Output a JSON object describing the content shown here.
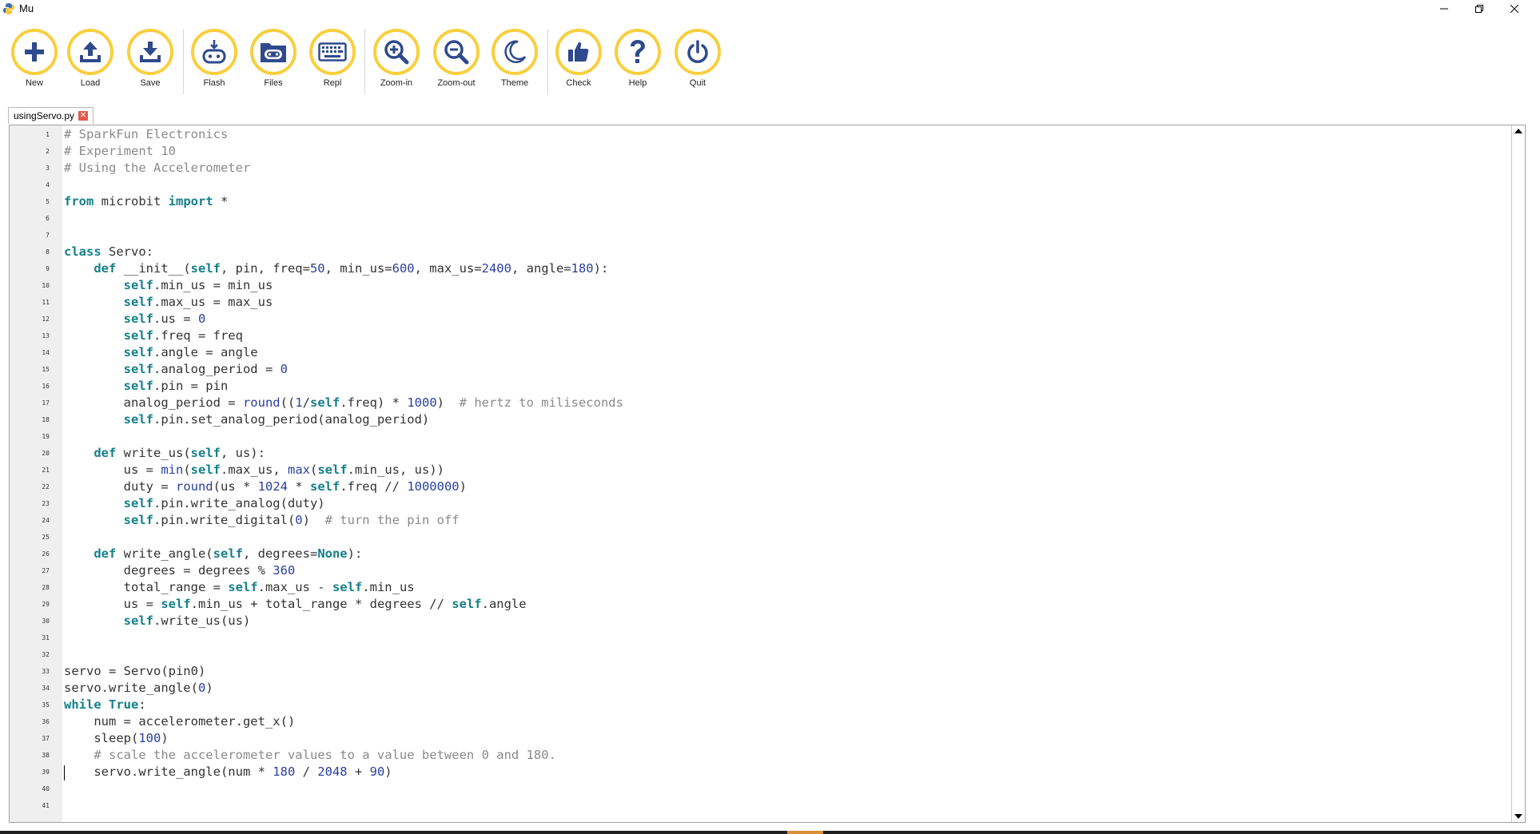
{
  "window": {
    "title": "Mu"
  },
  "toolbar": {
    "buttons": [
      {
        "id": "new",
        "label": "New",
        "icon": "plus-icon"
      },
      {
        "id": "load",
        "label": "Load",
        "icon": "upload-icon"
      },
      {
        "id": "save",
        "label": "Save",
        "icon": "download-icon"
      },
      {
        "id": "flash",
        "label": "Flash",
        "icon": "flash-icon"
      },
      {
        "id": "files",
        "label": "Files",
        "icon": "files-icon"
      },
      {
        "id": "repl",
        "label": "Repl",
        "icon": "keyboard-icon"
      },
      {
        "id": "zoom-in",
        "label": "Zoom-in",
        "icon": "zoom-in-icon"
      },
      {
        "id": "zoom-out",
        "label": "Zoom-out",
        "icon": "zoom-out-icon"
      },
      {
        "id": "theme",
        "label": "Theme",
        "icon": "moon-icon"
      },
      {
        "id": "check",
        "label": "Check",
        "icon": "thumbs-up-icon"
      },
      {
        "id": "help",
        "label": "Help",
        "icon": "question-icon"
      },
      {
        "id": "quit",
        "label": "Quit",
        "icon": "power-icon"
      }
    ]
  },
  "tab": {
    "filename": "usingServo.py",
    "close_glyph": "✕"
  },
  "editor": {
    "cursor_line": 39,
    "lines": [
      "# SparkFun Electronics",
      "# Experiment 10",
      "# Using the Accelerometer",
      "",
      "from microbit import *",
      "",
      "",
      "class Servo:",
      "    def __init__(self, pin, freq=50, min_us=600, max_us=2400, angle=180):",
      "        self.min_us = min_us",
      "        self.max_us = max_us",
      "        self.us = 0",
      "        self.freq = freq",
      "        self.angle = angle",
      "        self.analog_period = 0",
      "        self.pin = pin",
      "        analog_period = round((1/self.freq) * 1000)  # hertz to miliseconds",
      "        self.pin.set_analog_period(analog_period)",
      "",
      "    def write_us(self, us):",
      "        us = min(self.max_us, max(self.min_us, us))",
      "        duty = round(us * 1024 * self.freq // 1000000)",
      "        self.pin.write_analog(duty)",
      "        self.pin.write_digital(0)  # turn the pin off",
      "",
      "    def write_angle(self, degrees=None):",
      "        degrees = degrees % 360",
      "        total_range = self.max_us - self.min_us",
      "        us = self.min_us + total_range * degrees // self.angle",
      "        self.write_us(us)",
      "",
      "",
      "servo = Servo(pin0)",
      "servo.write_angle(0)",
      "while True:",
      "    num = accelerometer.get_x()",
      "    sleep(100)",
      "    # scale the accelerometer values to a value between 0 and 180.",
      "    servo.write_angle(num * 180 / 2048 + 90)",
      "",
      ""
    ]
  },
  "colors": {
    "accent": "#f8cf3e",
    "icon": "#2e4a8c",
    "keyword": "#15808a",
    "comment": "#8a8a8a",
    "number": "#2a3fa0"
  }
}
